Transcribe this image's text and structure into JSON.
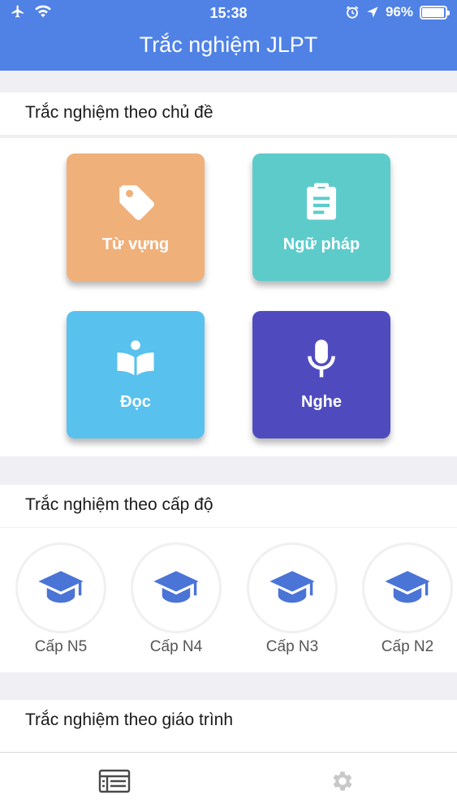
{
  "status_bar": {
    "time": "15:38",
    "battery": "96%",
    "battery_level": 0.96
  },
  "header": {
    "title": "Trắc nghiệm JLPT"
  },
  "sections": {
    "topic": {
      "title": "Trắc nghiệm theo chủ đề"
    },
    "level": {
      "title": "Trắc nghiệm theo cấp độ"
    },
    "textbook": {
      "title": "Trắc nghiệm theo giáo trình"
    }
  },
  "topics": [
    {
      "label": "Từ vựng",
      "icon": "tag-icon",
      "color": "#f0b07a"
    },
    {
      "label": "Ngữ pháp",
      "icon": "clipboard-icon",
      "color": "#5ecbcb"
    },
    {
      "label": "Đọc",
      "icon": "reading-book-icon",
      "color": "#58c1ee"
    },
    {
      "label": "Nghe",
      "icon": "microphone-icon",
      "color": "#4f4bbf"
    }
  ],
  "levels": [
    {
      "label": "Cấp N5",
      "icon": "graduation-cap-icon"
    },
    {
      "label": "Cấp N4",
      "icon": "graduation-cap-icon"
    },
    {
      "label": "Cấp N3",
      "icon": "graduation-cap-icon"
    },
    {
      "label": "Cấp N2",
      "icon": "graduation-cap-icon"
    }
  ],
  "tabbar": {
    "items": [
      "list-icon",
      "gear-icon"
    ]
  },
  "colors": {
    "header": "#5082e6",
    "cap": "#4a74d6"
  }
}
